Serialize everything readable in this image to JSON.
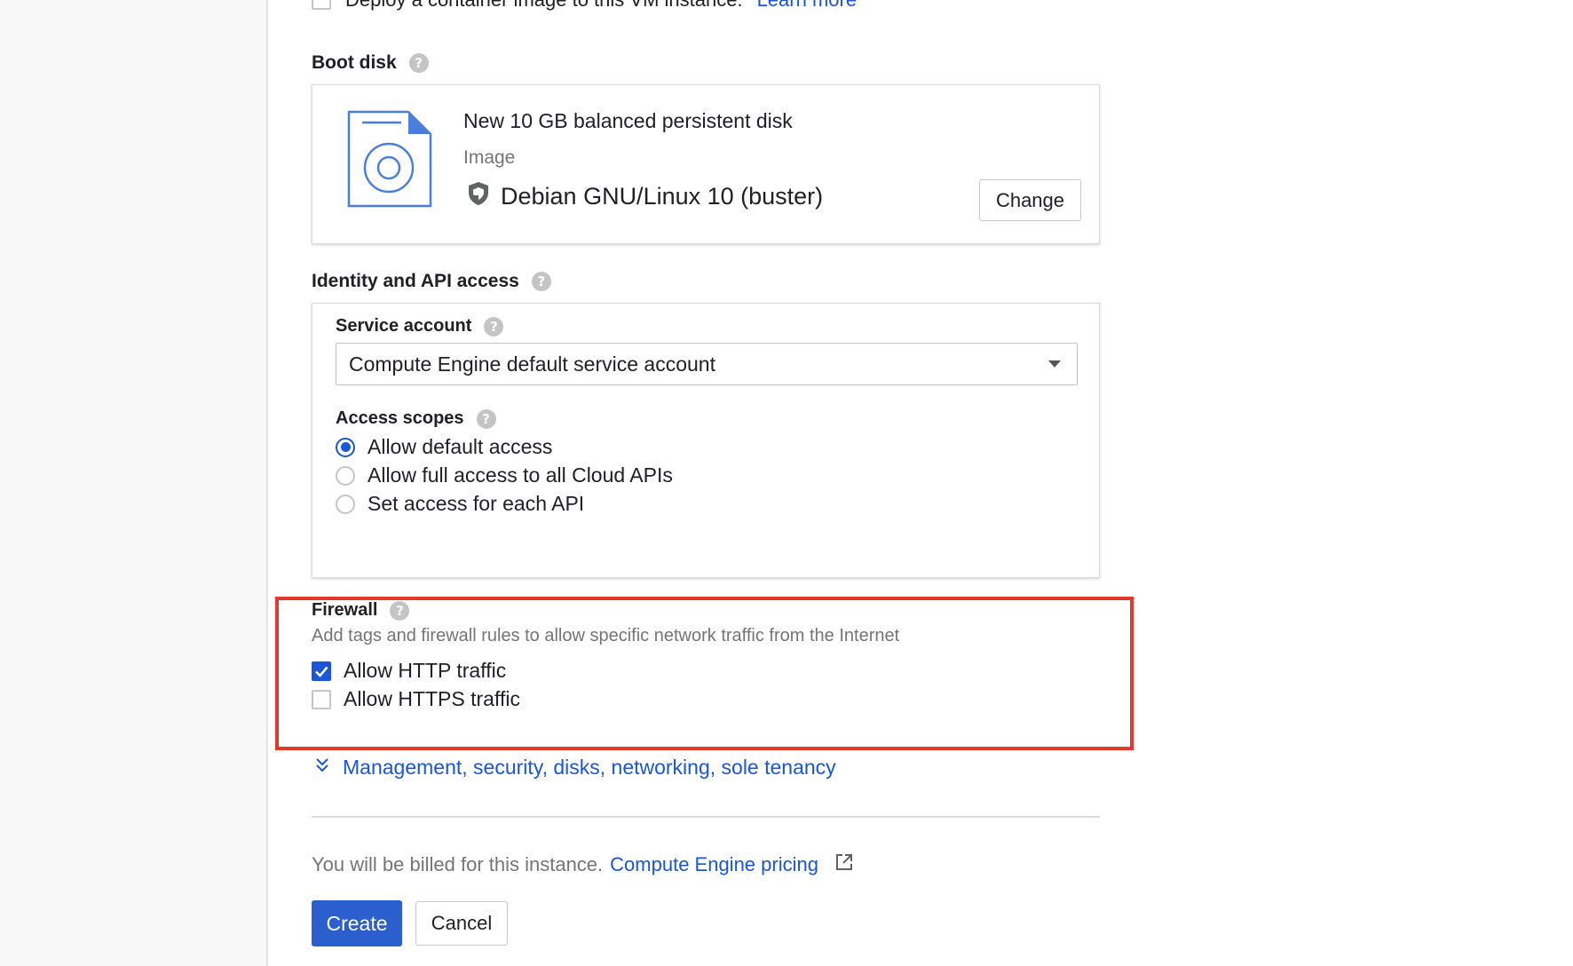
{
  "top_row": {
    "label": "Deploy a container image to this VM instance.",
    "link": "Learn more"
  },
  "boot_disk": {
    "section_label": "Boot disk",
    "title": "New 10 GB balanced persistent disk",
    "image_label": "Image",
    "image_name": "Debian GNU/Linux 10 (buster)",
    "change_button": "Change"
  },
  "identity": {
    "section_label": "Identity and API access",
    "service_account_label": "Service account",
    "service_account_value": "Compute Engine default service account",
    "access_scopes_label": "Access scopes",
    "scopes": [
      {
        "label": "Allow default access",
        "selected": true
      },
      {
        "label": "Allow full access to all Cloud APIs",
        "selected": false
      },
      {
        "label": "Set access for each API",
        "selected": false
      }
    ]
  },
  "firewall": {
    "section_label": "Firewall",
    "description": "Add tags and firewall rules to allow specific network traffic from the Internet",
    "options": [
      {
        "label": "Allow HTTP traffic",
        "checked": true
      },
      {
        "label": "Allow HTTPS traffic",
        "checked": false
      }
    ]
  },
  "management_link": "Management, security, disks, networking, sole tenancy",
  "billing": {
    "text": "You will be billed for this instance.",
    "link": "Compute Engine pricing"
  },
  "actions": {
    "create": "Create",
    "cancel": "Cancel"
  },
  "colors": {
    "accent": "#2b5fce",
    "link": "#1a56db",
    "highlight": "#e5372a"
  }
}
